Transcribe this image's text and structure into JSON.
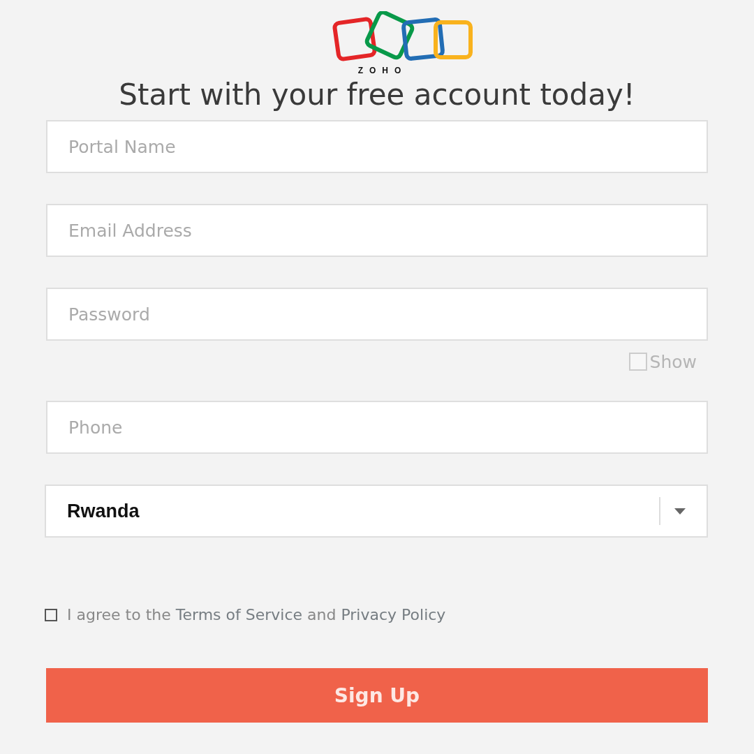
{
  "logo": {
    "text": "ZOHO"
  },
  "title": "Start with your free account today!",
  "fields": [
    {
      "placeholder": "Portal Name"
    },
    {
      "placeholder": "Email Address"
    },
    {
      "placeholder": "Password"
    }
  ],
  "show_password": {
    "label": "Show",
    "checked": false
  },
  "phone": {
    "placeholder": "Phone"
  },
  "country": {
    "value": "Rwanda"
  },
  "agreement": {
    "checked": false,
    "parts": [
      {
        "kind": "text",
        "text": "I agree to the"
      },
      {
        "kind": "link",
        "text": "Terms of Service"
      },
      {
        "kind": "text",
        "text": "and"
      },
      {
        "kind": "link",
        "text": "Privacy Policy"
      }
    ]
  },
  "button": "Sign Up"
}
